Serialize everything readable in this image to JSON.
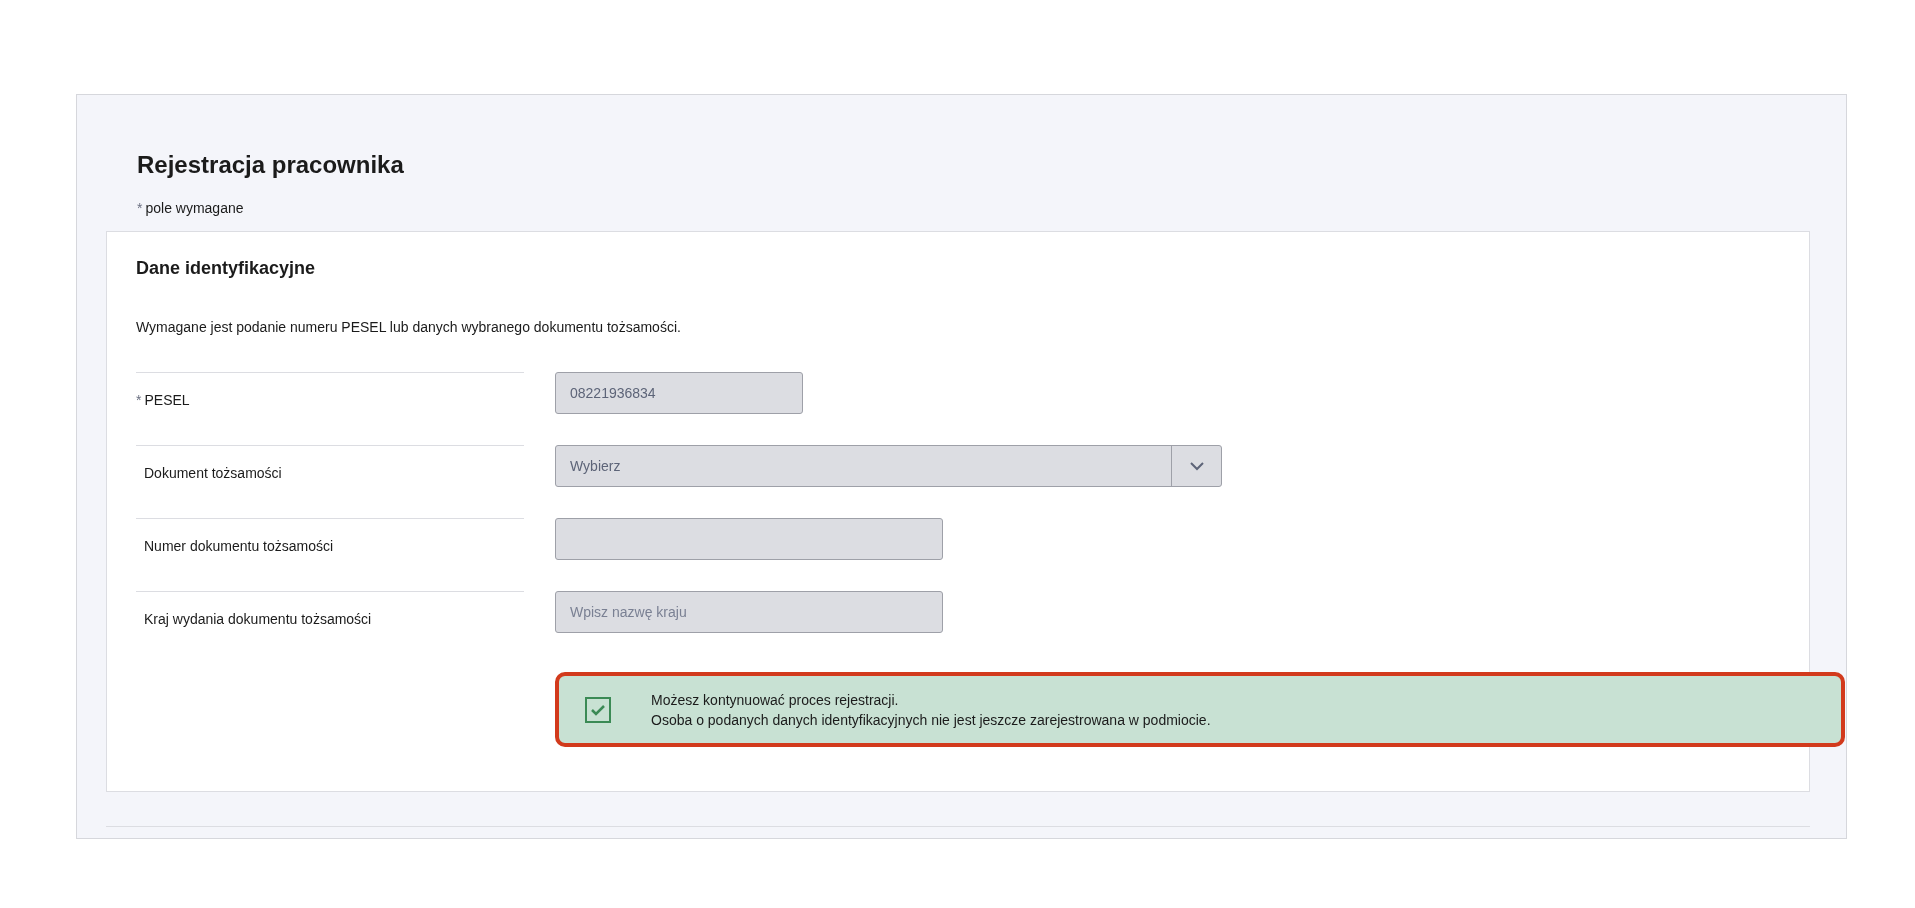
{
  "page_title": "Rejestracja pracownika",
  "required_note": {
    "mark": "*",
    "text": "pole wymagane"
  },
  "section": {
    "title": "Dane identyfikacyjne",
    "description": "Wymagane jest podanie numeru PESEL lub danych wybranego dokumentu tożsamości.",
    "fields": [
      {
        "kind": "input",
        "required_mark": "*",
        "label": "PESEL",
        "value": "08221936834"
      },
      {
        "kind": "select",
        "label": "Dokument tożsamości",
        "value": "Wybierz"
      },
      {
        "kind": "input",
        "label": "Numer dokumentu tożsamości"
      },
      {
        "kind": "input",
        "label": "Kraj wydania dokumentu tożsamości",
        "placeholder": "Wpisz nazwę kraju"
      }
    ],
    "alert": {
      "kind": "success",
      "highlighted": true,
      "lines": [
        "Możesz kontynuować proces rejestracji.",
        "Osoba o podanych danych identyfikacyjnych nie jest jeszcze zarejestrowana w podmiocie."
      ]
    }
  }
}
